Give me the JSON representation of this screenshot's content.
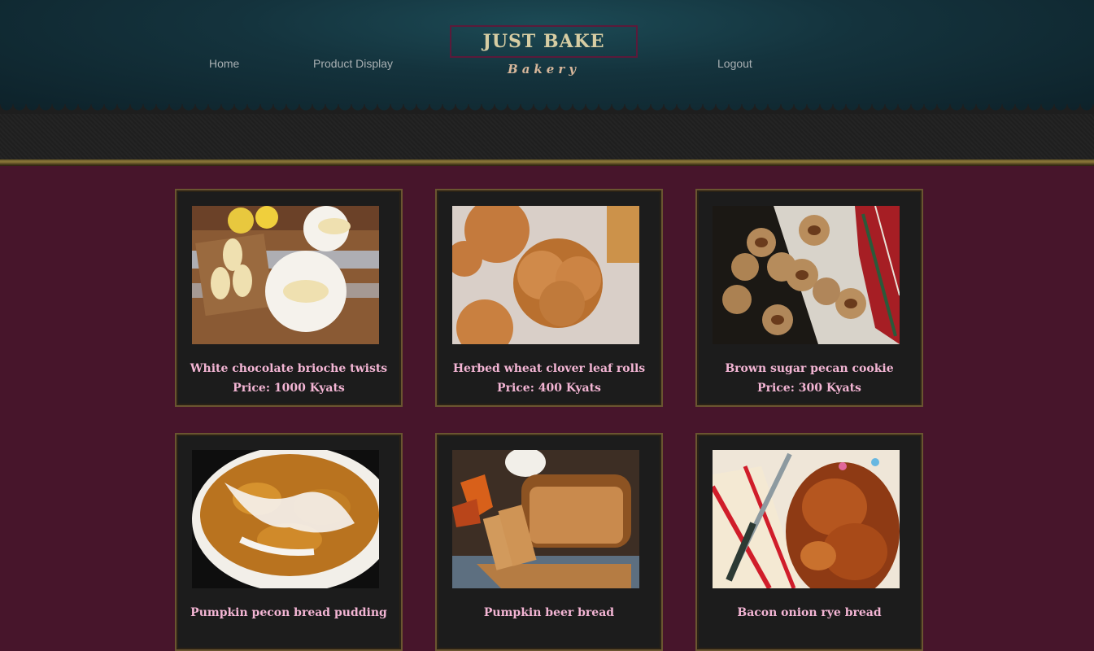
{
  "header": {
    "nav": [
      "Home",
      "Product Display",
      "Logout"
    ],
    "logo_title": "JUST BAKE",
    "logo_subtitle": "Bakery"
  },
  "colors": {
    "background": "#47152b",
    "card_bg": "#1c1c1c",
    "card_border": "#6a5530",
    "text_pink": "#f3b5d4",
    "logo_gold": "#d7cda3"
  },
  "products": [
    {
      "name": "White chocolate brioche twists",
      "price": "Price: 1000 Kyats"
    },
    {
      "name": "Herbed wheat clover leaf rolls",
      "price": "Price: 400 Kyats"
    },
    {
      "name": "Brown sugar pecan cookie",
      "price": "Price: 300 Kyats"
    },
    {
      "name": "Pumpkin pecon bread pudding",
      "price": ""
    },
    {
      "name": "Pumpkin beer bread",
      "price": ""
    },
    {
      "name": "Bacon onion rye bread",
      "price": ""
    }
  ]
}
